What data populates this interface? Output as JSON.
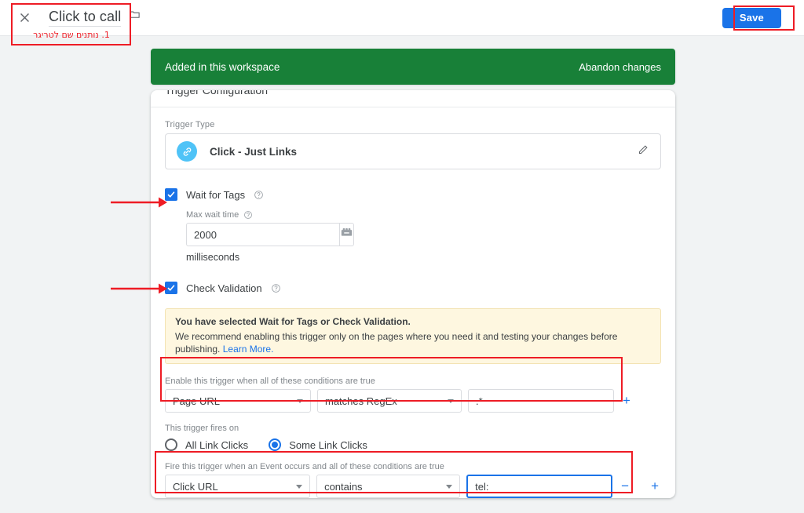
{
  "topbar": {
    "close_icon": "close-icon",
    "title": "Click to call",
    "folder_icon": "folder-icon",
    "save_label": "Save",
    "more_icon": "more-vertical-icon"
  },
  "annotations": {
    "hebrew_note": "1. נותנים שם לטריגר",
    "color": "#ee1c25",
    "arrow_targets": [
      "wait-for-tags-checkbox",
      "check-validation-checkbox"
    ],
    "boxes": [
      "trigger-name",
      "save-button",
      "enable-conditions-row",
      "event-conditions-row"
    ]
  },
  "banner": {
    "message": "Added in this workspace",
    "action_label": "Abandon changes",
    "color": "#188038"
  },
  "card": {
    "header": "Trigger Configuration",
    "trigger_type": {
      "label": "Trigger Type",
      "icon": "link-icon",
      "name": "Click - Just Links",
      "edit_icon": "pencil-icon"
    },
    "wait_for_tags": {
      "label": "Wait for Tags",
      "checked": true,
      "help_icon": "help-circle-icon",
      "max_wait_label": "Max wait time",
      "max_wait_value": "2000",
      "max_wait_placeholder": "",
      "variable_icon": "insert-variable-icon",
      "unit": "milliseconds"
    },
    "check_validation": {
      "label": "Check Validation",
      "checked": true,
      "help_icon": "help-circle-icon"
    },
    "notice": {
      "title": "You have selected Wait for Tags or Check Validation.",
      "body": "We recommend enabling this trigger only on the pages where you need it and testing your changes before publishing.",
      "link_label": "Learn More."
    },
    "enable_conditions": {
      "label": "Enable this trigger when all of these conditions are true",
      "rows": [
        {
          "variable": "Page URL",
          "operator": "matches RegEx",
          "value": ".*",
          "value_placeholder": "",
          "add_label": "+"
        }
      ]
    },
    "fires_on": {
      "label": "This trigger fires on",
      "options": [
        {
          "label": "All Link Clicks",
          "selected": false
        },
        {
          "label": "Some Link Clicks",
          "selected": true
        }
      ]
    },
    "event_conditions": {
      "label": "Fire this trigger when an Event occurs and all of these conditions are true",
      "rows": [
        {
          "variable": "Click URL",
          "operator": "contains",
          "value": "tel:",
          "value_placeholder": "",
          "remove_label": "−",
          "add_label": "+"
        }
      ]
    }
  }
}
